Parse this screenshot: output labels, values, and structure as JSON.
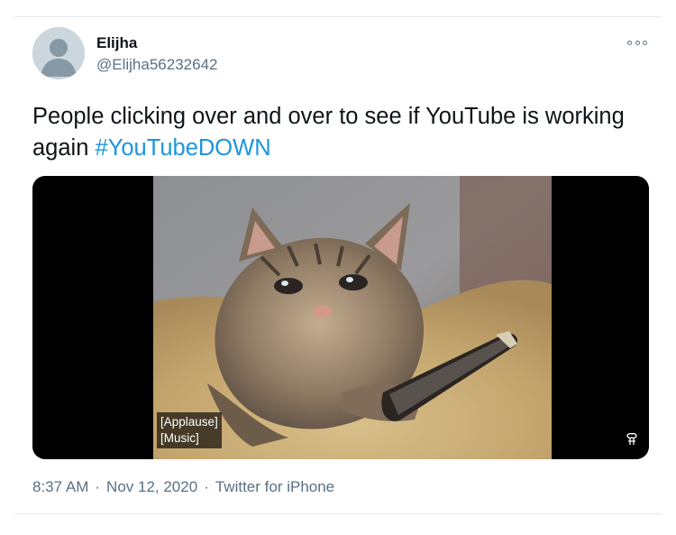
{
  "tweet": {
    "display_name": "Elijha",
    "handle": "@Elijha56232642",
    "text_main": "People clicking over and over to see if YouTube is working again ",
    "hashtag": "#YouTubeDOWN",
    "time": "8:37 AM",
    "date": "Nov 12, 2020",
    "source": "Twitter for iPhone",
    "separator": "·"
  },
  "media": {
    "captions": [
      "[Applause]",
      "[Music]"
    ],
    "icon": "gif-badge-icon"
  },
  "colors": {
    "text": "#0f1419",
    "secondary": "#5b7083",
    "link": "#1b95e0",
    "border": "#e6ecf0"
  }
}
